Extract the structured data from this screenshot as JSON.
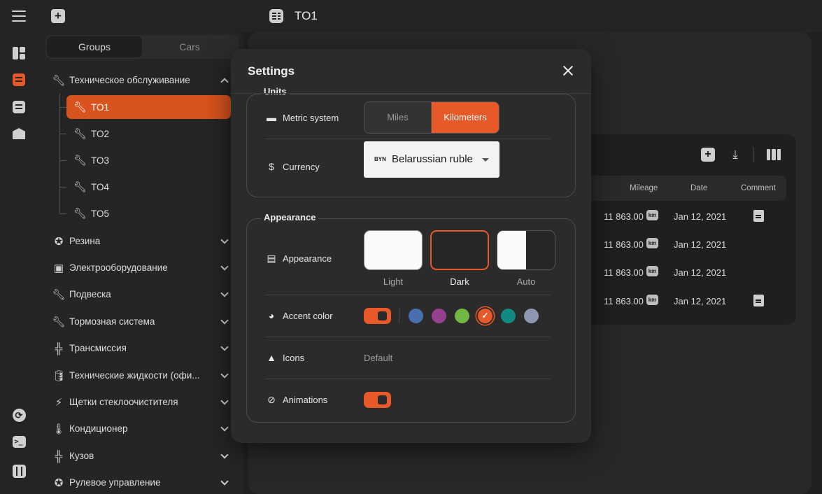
{
  "header": {
    "title": "TO1"
  },
  "sidebar": {
    "tabs": {
      "groups": "Groups",
      "cars": "Cars"
    },
    "groups": [
      {
        "label": "Техническое обслуживание",
        "expanded": true
      },
      {
        "label": "Резина"
      },
      {
        "label": "Электрооборудование"
      },
      {
        "label": "Подвеска"
      },
      {
        "label": "Тормозная система"
      },
      {
        "label": "Трансмиссия"
      },
      {
        "label": "Технические жидкости (офи..."
      },
      {
        "label": "Щетки стеклоочистителя"
      },
      {
        "label": "Кондиционер"
      },
      {
        "label": "Кузов"
      },
      {
        "label": "Рулевое управление"
      }
    ],
    "subitems": [
      {
        "label": "TO1",
        "active": true
      },
      {
        "label": "TO2"
      },
      {
        "label": "TO3"
      },
      {
        "label": "TO4"
      },
      {
        "label": "TO5"
      }
    ]
  },
  "table": {
    "columns": {
      "mileage": "Mileage",
      "date": "Date",
      "comment": "Comment"
    },
    "unit_badge": "km",
    "rows": [
      {
        "mileage": "11 863.00",
        "date": "Jan 12, 2021",
        "has_comment": true
      },
      {
        "mileage": "11 863.00",
        "date": "Jan 12, 2021",
        "has_comment": false
      },
      {
        "mileage": "11 863.00",
        "date": "Jan 12, 2021",
        "has_comment": false
      },
      {
        "mileage": "11 863.00",
        "date": "Jan 12, 2021",
        "has_comment": true
      }
    ]
  },
  "settings": {
    "title": "Settings",
    "units": {
      "legend": "Units",
      "metric_label": "Metric system",
      "miles": "Miles",
      "kilometers": "Kilometers",
      "selected": "Kilometers",
      "currency_label": "Currency",
      "currency_code": "BYN",
      "currency_name": "Belarussian ruble"
    },
    "appearance": {
      "legend": "Appearance",
      "appearance_label": "Appearance",
      "themes": {
        "light": "Light",
        "dark": "Dark",
        "auto": "Auto"
      },
      "selected_theme": "Dark",
      "accent_label": "Accent color",
      "accent_colors": [
        "#4a6fae",
        "#96418f",
        "#71b843",
        "#e8592a",
        "#138a81",
        "#8d97b0"
      ],
      "selected_accent": "#e8592a",
      "icons_label": "Icons",
      "icons_value": "Default",
      "animations_label": "Animations",
      "animations_on": true
    }
  },
  "colors": {
    "accent": "#e8592a",
    "background": "#202020",
    "modal": "#2b2b2b"
  }
}
